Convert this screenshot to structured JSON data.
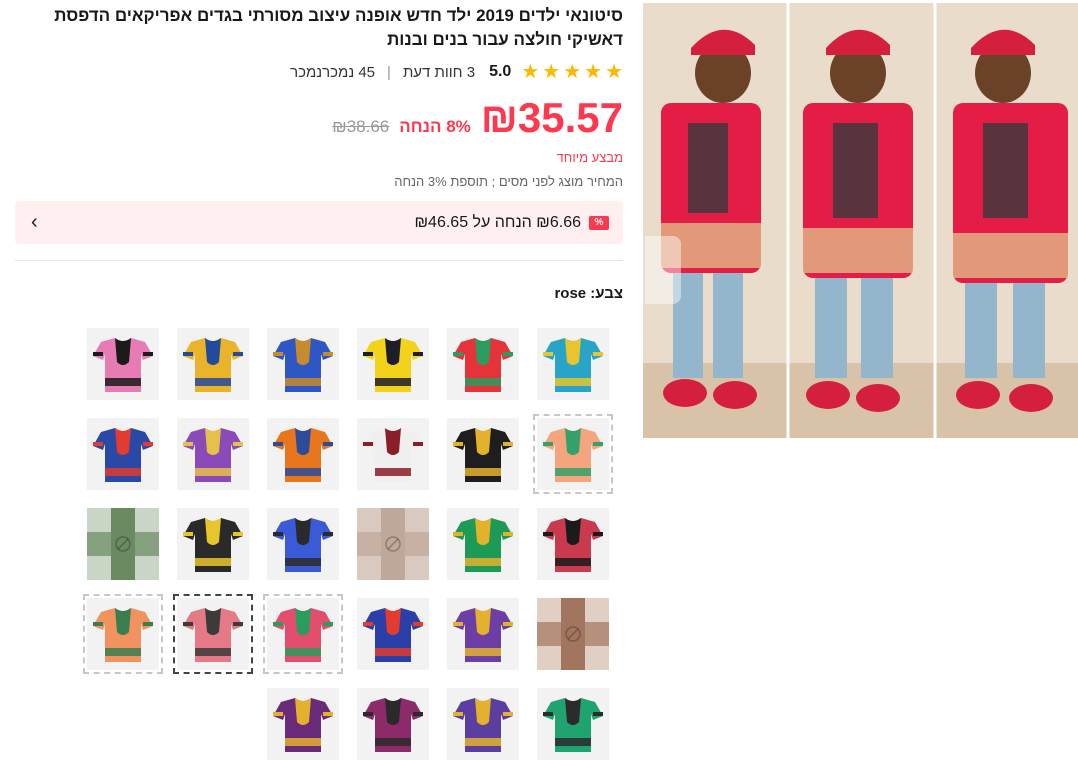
{
  "product": {
    "title": "סיטונאי ילדים 2019 ילד חדש אופנה עיצוב מסורתי בגדים אפריקאים הדפסת דאשיקי חולצה עבור בנים ובנות",
    "rating_score": "5.0",
    "reviews": "3 חוות דעת",
    "sold": "45 נמכרנמכר",
    "price": "₪35.57",
    "discount": "8% הנחה",
    "old_price": "₪38.66",
    "special_label": "מבצע מיוחד",
    "tax_note": "המחיר מוצג לפני מסים ; תוספת 3% הנחה",
    "coupon_text": "₪6.66 הנחה על ₪46.65",
    "coupon_badge": "%",
    "color_label": "צבע: rose"
  },
  "icons": {
    "star": "star-icon",
    "chevron": "chevron-left-icon",
    "coupon": "percent-coupon-icon"
  },
  "swatches": [
    {
      "main": "#27a4c8",
      "trim": "#e8c52c"
    },
    {
      "main": "#e63239",
      "trim": "#2a9c5e"
    },
    {
      "main": "#f2d21a",
      "trim": "#1d1d2b"
    },
    {
      "main": "#2e56c4",
      "trim": "#c88b2c"
    },
    {
      "main": "#e9b42a",
      "trim": "#224b9c"
    },
    {
      "main": "#e77cb4",
      "trim": "#1b1b1b"
    },
    {
      "main": "#f5a57e",
      "trim": "#34a06a",
      "dashed": true
    },
    {
      "main": "#1e1e1e",
      "trim": "#e4b12d"
    },
    {
      "main": "#efefef",
      "trim": "#8a1f2a"
    },
    {
      "main": "#e8761c",
      "trim": "#2b4c9b"
    },
    {
      "main": "#8a4bb8",
      "trim": "#e6c14a"
    },
    {
      "main": "#2a49a7",
      "trim": "#e23b2f"
    },
    {
      "main": "#c93a4e",
      "trim": "#1b1b1b"
    },
    {
      "main": "#1e9a57",
      "trim": "#e4b12d"
    },
    {
      "placeholder": true,
      "c1": "#bfa79a",
      "c2": "#d9c9c0"
    },
    {
      "main": "#3a5ad8",
      "trim": "#2a2a2a"
    },
    {
      "main": "#2a2a2a",
      "trim": "#e8c52c"
    },
    {
      "placeholder": true,
      "c1": "#6a8a62",
      "c2": "#c9d6c6"
    },
    {
      "placeholder": true,
      "c1": "#a2755f",
      "c2": "#e2cfc4"
    },
    {
      "main": "#6d3fa6",
      "trim": "#e4b12d"
    },
    {
      "main": "#2a3fa8",
      "trim": "#e23b2f"
    },
    {
      "main": "#e34e6e",
      "trim": "#2a9c5e",
      "dashed": true
    },
    {
      "main": "#e37a86",
      "trim": "#3b3b3b",
      "selected": true
    },
    {
      "main": "#f2925e",
      "trim": "#3a7d4e",
      "dashed": true
    },
    {
      "main": "#1fa470",
      "trim": "#2b2b2b"
    },
    {
      "main": "#5b3fa0",
      "trim": "#e4b12d"
    },
    {
      "main": "#8c2a6a",
      "trim": "#2a2a2a"
    },
    {
      "main": "#6a2a7a",
      "trim": "#e4b12d"
    }
  ]
}
